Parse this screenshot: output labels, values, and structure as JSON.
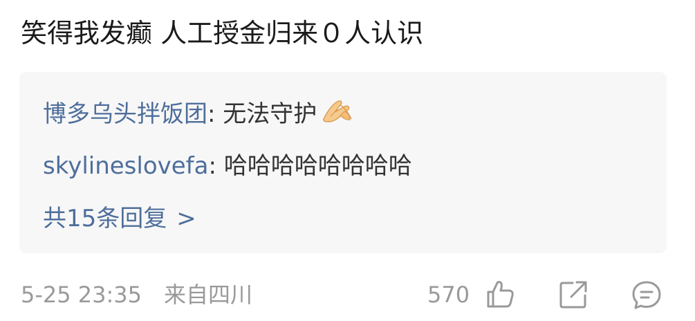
{
  "comment": {
    "text": "笑得我发癫  人工授金归来０人认识"
  },
  "replies": [
    {
      "user": "博多乌头拌饭团",
      "separator": ": ",
      "text": "无法守护",
      "emoji": "pinched-hands-emoji"
    },
    {
      "user": "skylineslovefa",
      "separator": ": ",
      "text": "哈哈哈哈哈哈哈哈"
    }
  ],
  "more_replies": {
    "label": "共15条回复",
    "chevron": ">"
  },
  "footer": {
    "time": "5-25 23:35",
    "source": "来自四川",
    "like_count": "570",
    "icons": [
      "like-icon",
      "share-icon",
      "comment-icon"
    ]
  },
  "colors": {
    "username": "#4e6e9b",
    "meta": "#999999",
    "reply_bg": "#f7f7f7",
    "text": "#1a1a1a"
  }
}
